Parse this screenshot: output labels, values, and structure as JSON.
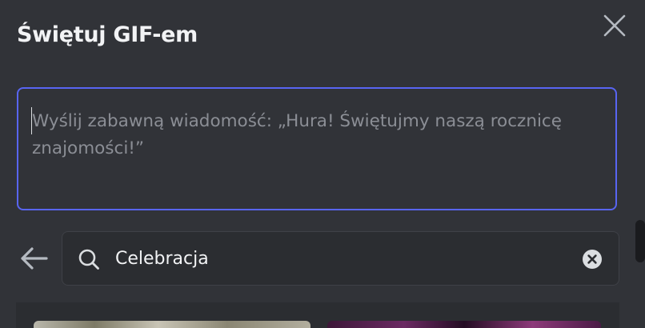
{
  "header": {
    "title": "Świętuj GIF-em"
  },
  "message": {
    "placeholder": "Wyślij zabawną wiadomość: „Hura! Świętujmy naszą rocznicę znajomości!”"
  },
  "search": {
    "query": "Celebracja"
  },
  "icons": {
    "close": "close-icon",
    "back": "arrow-left-icon",
    "search": "search-icon",
    "clear": "clear-circle-x-icon"
  },
  "colors": {
    "background": "#313338",
    "accent": "#5865f2",
    "search_background": "#2b2d31",
    "title_text": "#f2f3f5",
    "placeholder_text": "#8b8e95"
  }
}
